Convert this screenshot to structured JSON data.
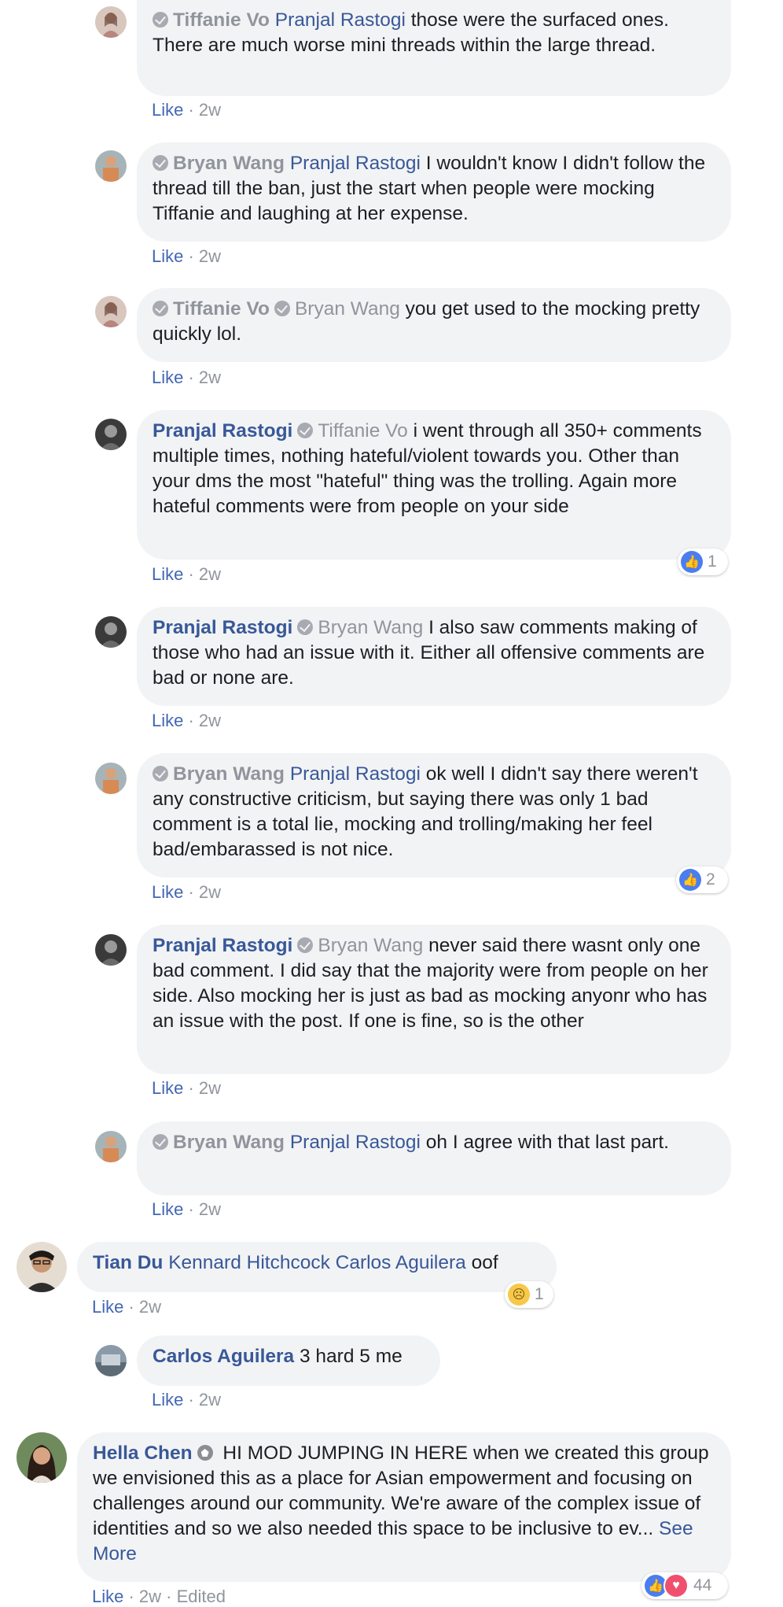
{
  "comments": [
    {
      "author": "Tiffanie Vo",
      "mention": "Pranjal Rastogi",
      "text": " those were the surfaced ones. There are much worse mini threads within the large thread.",
      "like": "Like",
      "time": "2w"
    },
    {
      "author": "Bryan Wang",
      "mention": "Pranjal Rastogi",
      "text": " I wouldn't know I didn't follow the thread till the ban, just the start when people were mocking Tiffanie and laughing at her expense.",
      "like": "Like",
      "time": "2w"
    },
    {
      "author": "Tiffanie Vo",
      "mention": "Bryan Wang",
      "text": " you get used to the mocking pretty quickly lol.",
      "like": "Like",
      "time": "2w"
    },
    {
      "author": "Pranjal Rastogi",
      "mention": "Tiffanie Vo",
      "text": " i went through all 350+ comments multiple times, nothing hateful/violent towards you. Other than your dms the most \"hateful\" thing was the trolling. Again more hateful comments were from people on your side",
      "like": "Like",
      "time": "2w",
      "reaction_count": "1"
    },
    {
      "author": "Pranjal Rastogi",
      "mention": "Bryan Wang",
      "text": " I also saw comments making of those who had an issue with it. Either all offensive comments are bad or none are.",
      "like": "Like",
      "time": "2w"
    },
    {
      "author": "Bryan Wang",
      "mention": "Pranjal Rastogi",
      "text": " ok well I didn't say there weren't any constructive criticism, but saying there was only 1 bad comment is a total lie, mocking and trolling/making her feel bad/embarassed is not nice.",
      "like": "Like",
      "time": "2w",
      "reaction_count": "2"
    },
    {
      "author": "Pranjal Rastogi",
      "mention": "Bryan Wang",
      "text": " never said there wasnt only one bad comment. I did say that the majority were from people on her side. Also mocking her is just as bad as mocking anyonr who has an issue with the post. If one is fine, so is the other",
      "like": "Like",
      "time": "2w"
    },
    {
      "author": "Bryan Wang",
      "mention": "Pranjal Rastogi",
      "text": " oh I agree with that last part.",
      "like": "Like",
      "time": "2w"
    },
    {
      "author": "Tian Du",
      "mention": "Kennard Hitchcock Carlos Aguilera",
      "text": " oof",
      "like": "Like",
      "time": "2w",
      "reaction_count": "1"
    },
    {
      "author": "Carlos Aguilera",
      "text": " 3 hard 5 me",
      "like": "Like",
      "time": "2w"
    },
    {
      "author": "Hella Chen",
      "text": " HI MOD JUMPING IN HERE when we created this group we envisioned this as a place for Asian empowerment and focusing on challenges around our community. We're aware of the complex issue of identities and so we also needed this space to be inclusive to ev... ",
      "see_more": "See More",
      "like": "Like",
      "time": "2w",
      "edited": "Edited",
      "reaction_count": "44"
    }
  ],
  "colors": {
    "link": "#385898",
    "meta": "#90949c",
    "bubble": "#f2f3f5",
    "like_blue": "#4267b2"
  }
}
